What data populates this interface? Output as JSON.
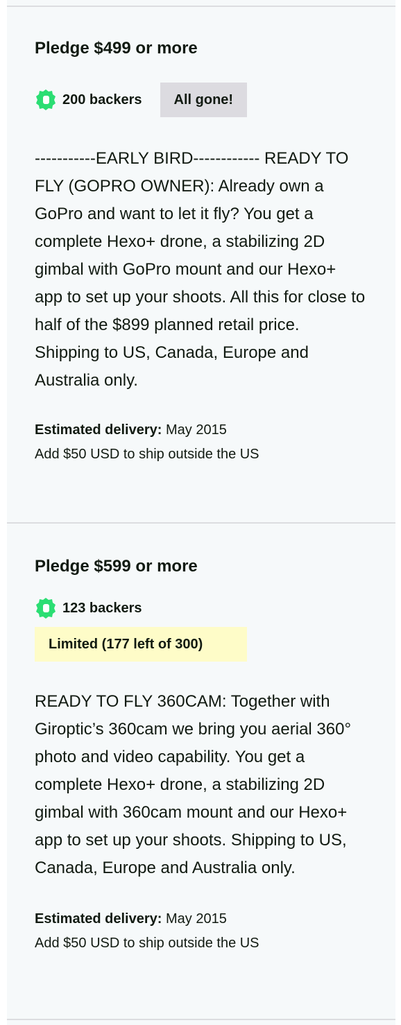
{
  "rewards": [
    {
      "title": "Pledge $499 or more",
      "backers": "200 backers",
      "status": "All gone!",
      "description": "-----------EARLY BIRD------------ READY TO FLY (GOPRO OWNER): Already own a GoPro and want to let it fly? You get a complete Hexo+ drone, a stabilizing 2D gimbal with GoPro mount and our Hexo+ app to set up your shoots. All this for close to half of the $899 planned retail price. Shipping to US, Canada, Europe and Australia only.",
      "delivery_label": "Estimated delivery:",
      "delivery_value": " May 2015",
      "shipping_note": "Add $50 USD to ship outside the US"
    },
    {
      "title": "Pledge $599 or more",
      "backers": "123 backers",
      "status": "Limited (177 left of 300)",
      "description": "READY TO FLY 360CAM: Together with Giroptic’s 360cam we bring you aerial 360° photo and video capability. You get a complete Hexo+ drone, a stabilizing 2D gimbal with 360cam mount and our Hexo+ app to set up your shoots. Shipping to US, Canada, Europe and Australia only.",
      "delivery_label": "Estimated delivery:",
      "delivery_value": " May 2015",
      "shipping_note": "Add $50 USD to ship outside the US"
    }
  ],
  "colors": {
    "badge": "#2bde73",
    "panel": "#f6f9fa",
    "gone": "#dcdbe0",
    "limited": "#fefcc8"
  }
}
